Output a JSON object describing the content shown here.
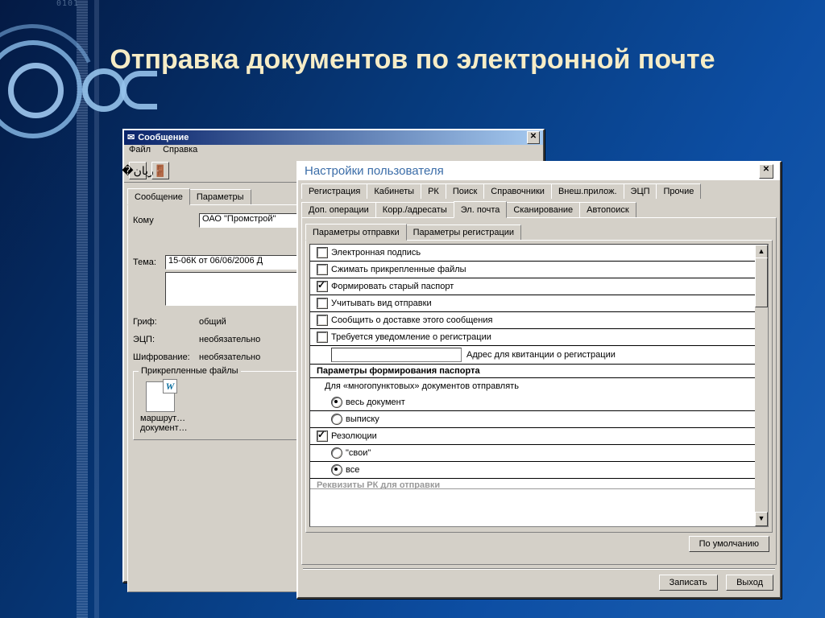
{
  "slide_title": "Отправка документов по электронной почте",
  "msg_window": {
    "title": "Сообщение",
    "menu": {
      "file": "Файл",
      "help": "Справка"
    },
    "tabs": {
      "message": "Сообщение",
      "params": "Параметры"
    },
    "to_label": "Кому",
    "to_value": "ОАО \"Промстрой\"",
    "subject_label": "Тема:",
    "subject_value": "15-06К от 06/06/2006 Д",
    "grif_label": "Гриф:",
    "grif_value": "общий",
    "ecp_label": "ЭЦП:",
    "ecp_value": "необязательно",
    "enc_label": "Шифрование:",
    "enc_value": "необязательно",
    "attach_group": "Прикрепленные файлы",
    "attach1": "маршрут…",
    "attach2": "документ…"
  },
  "settings_window": {
    "title": "Настройки пользователя",
    "tabs_row1": [
      "Регистрация",
      "Кабинеты",
      "РК",
      "Поиск",
      "Справочники",
      "Внеш.прилож.",
      "ЭЦП",
      "Прочие"
    ],
    "tabs_row2": [
      "Доп. операции",
      "Корр./адресаты",
      "Эл. почта",
      "Сканирование",
      "Автопоиск"
    ],
    "tabs_row2_active": 2,
    "subtabs": [
      "Параметры отправки",
      "Параметры регистрации"
    ],
    "subtabs_active": 0,
    "checks": [
      {
        "label": "Электронная подпись",
        "checked": false
      },
      {
        "label": "Сжимать прикрепленные файлы",
        "checked": false
      },
      {
        "label": "Формировать старый паспорт",
        "checked": true
      },
      {
        "label": "Учитывать вид отправки",
        "checked": false
      },
      {
        "label": "Сообщить о доставке этого сообщения",
        "checked": false
      },
      {
        "label": "Требуется уведомление о регистрации",
        "checked": false
      }
    ],
    "addr_label": "Адрес для квитанции о регистрации",
    "section1": "Параметры формирования паспорта",
    "section1_sub": "Для «многопунктовых» документов отправлять",
    "radios1": [
      {
        "label": "весь документ",
        "checked": true
      },
      {
        "label": "выписку",
        "checked": false
      }
    ],
    "resolutions": {
      "label": "Резолюции",
      "checked": true
    },
    "radios2": [
      {
        "label": "\"свои\"",
        "checked": false
      },
      {
        "label": "все",
        "checked": true
      }
    ],
    "cutoff_line": "Реквизиты РК для отправки",
    "default_btn": "По умолчанию",
    "save_btn": "Записать",
    "exit_btn": "Выход"
  }
}
